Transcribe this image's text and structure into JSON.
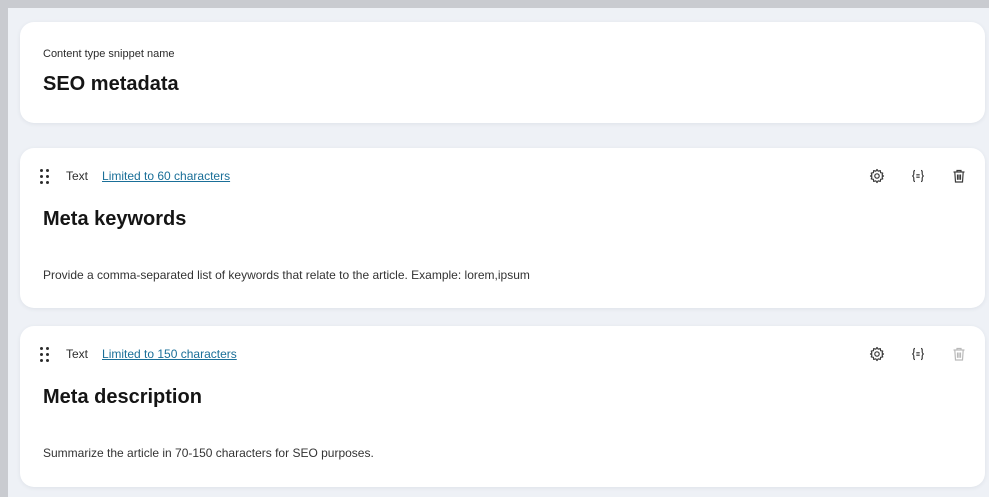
{
  "snippet": {
    "label": "Content type snippet name",
    "name": "SEO metadata"
  },
  "elements": [
    {
      "type": "Text",
      "limit": "Limited to 60 characters",
      "name": "Meta keywords",
      "guidelines": "Provide a comma-separated list of keywords that relate to the article. Example: lorem,ipsum",
      "delete_enabled": true
    },
    {
      "type": "Text",
      "limit": "Limited to 150 characters",
      "name": "Meta description",
      "guidelines": "Summarize the article in 70-150 characters for SEO purposes.",
      "delete_enabled": false
    }
  ],
  "icons": {
    "drag": "drag-handle-icon",
    "settings": "gear-icon",
    "condition": "braces-icon",
    "delete": "trash-icon"
  },
  "colors": {
    "link": "#1a6f98",
    "card": "#ffffff",
    "background": "#eef1f6",
    "text": "#151515"
  }
}
